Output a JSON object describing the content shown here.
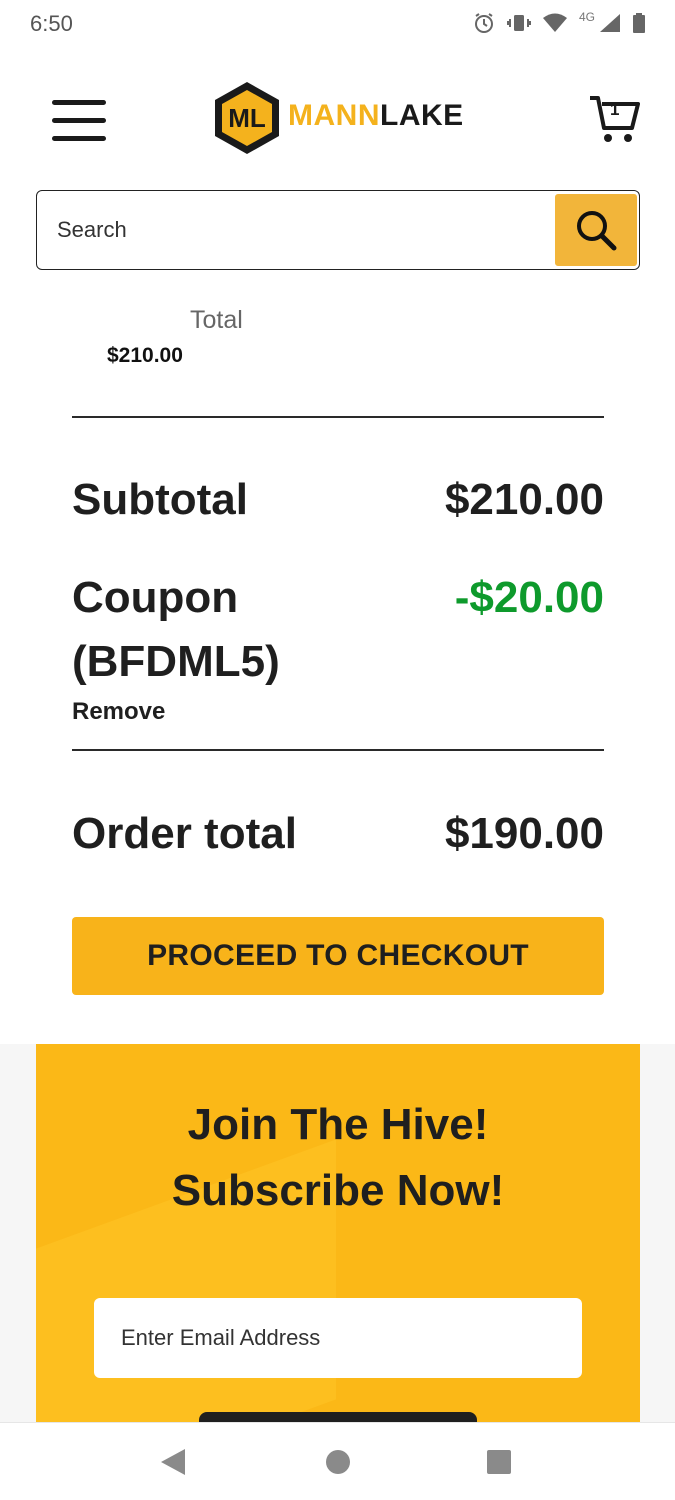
{
  "status_bar": {
    "time": "6:50",
    "network": "4G"
  },
  "header": {
    "logo_mark": "ML",
    "logo_word_1": "MANN",
    "logo_word_2": "LAKE",
    "cart_count": "1"
  },
  "search": {
    "placeholder": "Search"
  },
  "cart_line": {
    "total_label": "Total",
    "total_value": "$210.00"
  },
  "summary": {
    "subtotal_label": "Subtotal",
    "subtotal_value": "$210.00",
    "coupon_label_1": "Coupon",
    "coupon_label_2": "(BFDML5)",
    "coupon_value": "-$20.00",
    "remove_label": "Remove",
    "order_total_label": "Order total",
    "order_total_value": "$190.00"
  },
  "checkout": {
    "button_label": "PROCEED TO CHECKOUT"
  },
  "newsletter": {
    "title_1": "Join The Hive!",
    "title_2": "Subscribe Now!",
    "email_placeholder": "Enter Email Address"
  },
  "colors": {
    "brand_yellow": "#f8b31a",
    "discount_green": "#0e9a2c",
    "text_dark": "#1f1f1f"
  },
  "icons": {
    "menu": "hamburger-icon",
    "cart": "cart-icon",
    "search": "search-icon",
    "back": "back-triangle-icon",
    "home": "home-circle-icon",
    "recents": "recents-square-icon"
  }
}
